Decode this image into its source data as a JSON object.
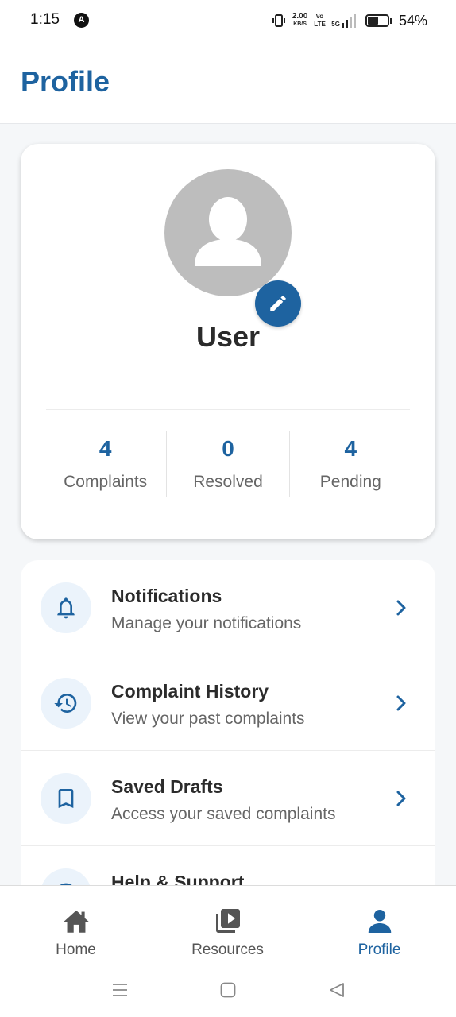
{
  "status_bar": {
    "time": "1:15",
    "notification_badge": "A",
    "net_speed_value": "2.00",
    "net_speed_unit": "KB/S",
    "volte": "Vo LTE",
    "network": "5G",
    "battery_percent": "54%",
    "battery_level": 0.54
  },
  "header": {
    "title": "Profile"
  },
  "profile": {
    "name": "User",
    "stats": [
      {
        "value": "4",
        "label": "Complaints"
      },
      {
        "value": "0",
        "label": "Resolved"
      },
      {
        "value": "4",
        "label": "Pending"
      }
    ]
  },
  "menu": {
    "items": [
      {
        "icon": "bell-icon",
        "title": "Notifications",
        "subtitle": "Manage your notifications"
      },
      {
        "icon": "history-icon",
        "title": "Complaint History",
        "subtitle": "View your past complaints"
      },
      {
        "icon": "bookmark-icon",
        "title": "Saved Drafts",
        "subtitle": "Access your saved complaints"
      },
      {
        "icon": "help-icon",
        "title": "Help & Support",
        "subtitle": ""
      }
    ]
  },
  "bottom_nav": {
    "items": [
      {
        "label": "Home",
        "icon": "home-icon",
        "active": false
      },
      {
        "label": "Resources",
        "icon": "video-library-icon",
        "active": false
      },
      {
        "label": "Profile",
        "icon": "person-icon",
        "active": true
      }
    ]
  },
  "colors": {
    "primary": "#1e63a0",
    "avatar_bg": "#bdbdbd",
    "icon_circle_bg": "#ebf3fb"
  }
}
